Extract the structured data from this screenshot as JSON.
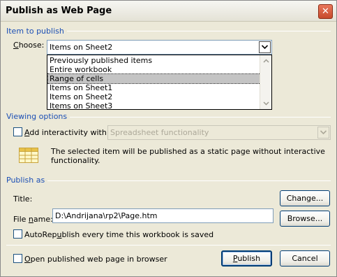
{
  "window": {
    "title": "Publish as Web Page",
    "close_label": "✕"
  },
  "item_to_publish": {
    "section": "Item to publish",
    "choose_label": "Choose:",
    "selected": "Items on Sheet2",
    "options": [
      "Previously published items",
      "Entire workbook",
      "Range of cells",
      "Items on Sheet1",
      "Items on Sheet2",
      "Items on Sheet3"
    ],
    "highlighted_option": "Range of cells"
  },
  "viewing_options": {
    "section": "Viewing options",
    "add_interactivity_label": "Add interactivity with:",
    "add_interactivity_checked": false,
    "interactivity_value": "Spreadsheet functionality",
    "info_text": "The selected item will be published as a static page without interactive functionality."
  },
  "publish_as": {
    "section": "Publish as",
    "title_label": "Title:",
    "change_button": "Change...",
    "file_name_label": "File name:",
    "file_name_value": "D:\\Andrijana\\rp2\\Page.htm",
    "browse_button": "Browse...",
    "autorepublish_label": "AutoRepublish every time this workbook is saved",
    "autorepublish_checked": false
  },
  "footer": {
    "open_in_browser_label": "Open published web page in browser",
    "open_in_browser_checked": false,
    "publish_button": "Publish",
    "cancel_button": "Cancel"
  },
  "colors": {
    "dialog_bg": "#ece9d8",
    "section_label": "#1c4fb5",
    "input_border": "#7f9db9",
    "selection_highlight": "#c4c4c4",
    "close_button": "#c74a2b"
  },
  "icons": {
    "close": "close-icon",
    "combo_arrow": "chevron-down-icon",
    "info": "spreadsheet-icon"
  }
}
